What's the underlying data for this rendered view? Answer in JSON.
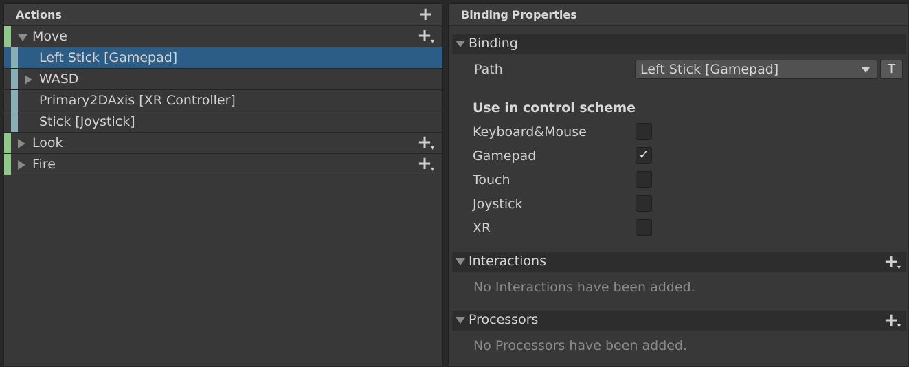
{
  "actions_panel": {
    "title": "Actions",
    "add_icon": "plus-icon",
    "rows": [
      {
        "kind": "action",
        "label": "Move",
        "expanded": true
      },
      {
        "kind": "binding",
        "label": "Left Stick [Gamepad]",
        "selected": true
      },
      {
        "kind": "binding",
        "label": "WASD",
        "composite": true,
        "expanded": false
      },
      {
        "kind": "binding",
        "label": "Primary2DAxis [XR Controller]"
      },
      {
        "kind": "binding",
        "label": "Stick [Joystick]"
      },
      {
        "kind": "action",
        "label": "Look",
        "expanded": false
      },
      {
        "kind": "action",
        "label": "Fire",
        "expanded": false
      }
    ]
  },
  "properties_panel": {
    "title": "Binding Properties",
    "binding_section": {
      "label": "Binding",
      "path_label": "Path",
      "path_value": "Left Stick [Gamepad]",
      "t_button": "T"
    },
    "control_scheme": {
      "heading": "Use in control scheme",
      "schemes": [
        {
          "label": "Keyboard&Mouse",
          "checked": false
        },
        {
          "label": "Gamepad",
          "checked": true
        },
        {
          "label": "Touch",
          "checked": false
        },
        {
          "label": "Joystick",
          "checked": false
        },
        {
          "label": "XR",
          "checked": false
        }
      ]
    },
    "interactions_section": {
      "label": "Interactions",
      "empty_message": "No Interactions have been added."
    },
    "processors_section": {
      "label": "Processors",
      "empty_message": "No Processors have been added."
    }
  },
  "colors": {
    "selection": "#2c5d87",
    "action_bar": "#8fc989",
    "binding_bar": "#89aeb6"
  }
}
